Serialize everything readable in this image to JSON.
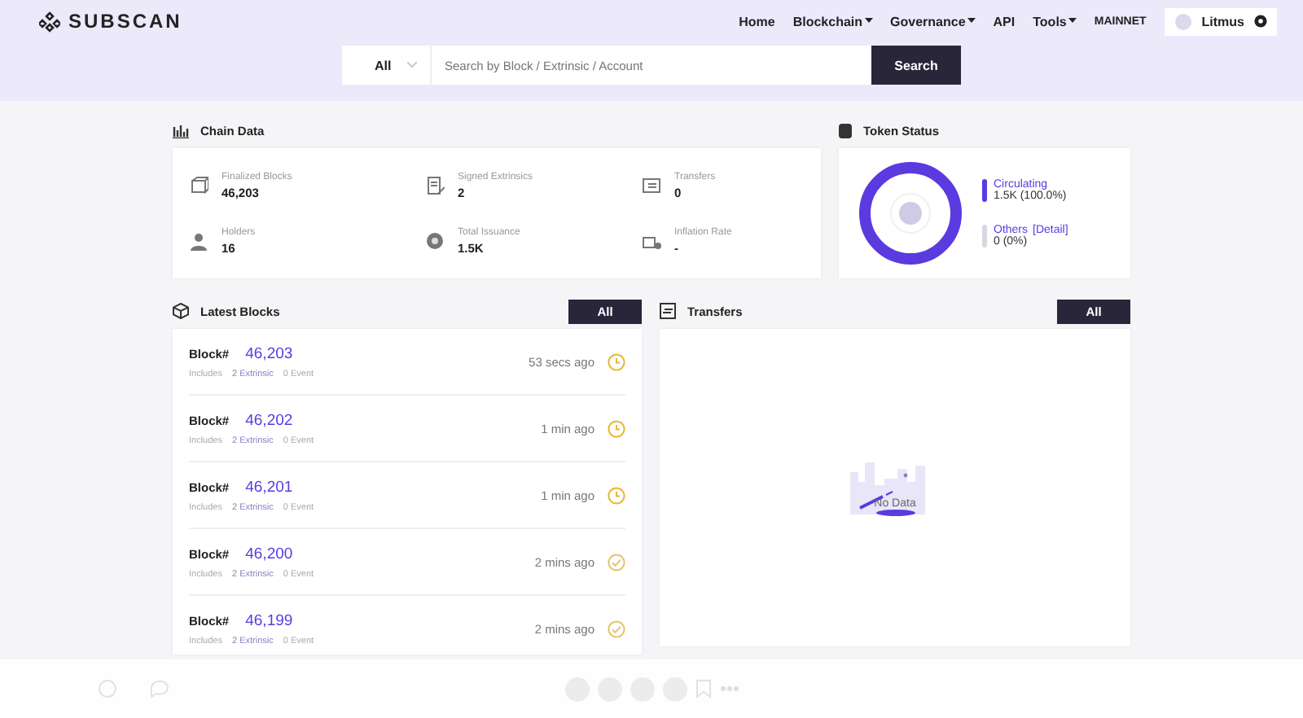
{
  "header": {
    "logo": "SUBSCAN",
    "nav": [
      {
        "label": "Home",
        "dropdown": false
      },
      {
        "label": "Blockchain",
        "dropdown": true
      },
      {
        "label": "Governance",
        "dropdown": true
      },
      {
        "label": "API",
        "dropdown": false
      },
      {
        "label": "Tools",
        "dropdown": true
      }
    ],
    "network": "MAINNET",
    "chain": "Litmus"
  },
  "search": {
    "filter": "All",
    "placeholder": "Search by Block / Extrinsic / Account",
    "button": "Search"
  },
  "chain_data": {
    "title": "Chain Data",
    "stats": [
      {
        "label": "Finalized Blocks",
        "value": "46,203"
      },
      {
        "label": "Signed Extrinsics",
        "value": "2"
      },
      {
        "label": "Transfers",
        "value": "0"
      },
      {
        "label": "Holders",
        "value": "16"
      },
      {
        "label": "Total Issuance",
        "value": "1.5K"
      },
      {
        "label": "Inflation Rate",
        "value": "-"
      }
    ]
  },
  "token_status": {
    "title": "Token Status",
    "legend": [
      {
        "label": "Circulating",
        "value": "1.5K  (100.0%)",
        "color": "#5b3ae0"
      },
      {
        "label": "Others",
        "link": "[Detail]",
        "value": "0  (0%)",
        "color": "#d8d8e0"
      }
    ]
  },
  "latest_blocks": {
    "title": "Latest Blocks",
    "button": "All",
    "rows": [
      {
        "prefix": "Block#",
        "number": "46,203",
        "includes": "Includes",
        "extrinsics": "2 Extrinsic",
        "events": "0 Event",
        "time": "53 secs ago",
        "finalized": false
      },
      {
        "prefix": "Block#",
        "number": "46,202",
        "includes": "Includes",
        "extrinsics": "2 Extrinsic",
        "events": "0 Event",
        "time": "1 min ago",
        "finalized": false
      },
      {
        "prefix": "Block#",
        "number": "46,201",
        "includes": "Includes",
        "extrinsics": "2 Extrinsic",
        "events": "0 Event",
        "time": "1 min ago",
        "finalized": false
      },
      {
        "prefix": "Block#",
        "number": "46,200",
        "includes": "Includes",
        "extrinsics": "2 Extrinsic",
        "events": "0 Event",
        "time": "2 mins ago",
        "finalized": true
      },
      {
        "prefix": "Block#",
        "number": "46,199",
        "includes": "Includes",
        "extrinsics": "2 Extrinsic",
        "events": "0 Event",
        "time": "2 mins ago",
        "finalized": true
      }
    ]
  },
  "transfers": {
    "title": "Transfers",
    "button": "All",
    "empty": "No Data"
  }
}
